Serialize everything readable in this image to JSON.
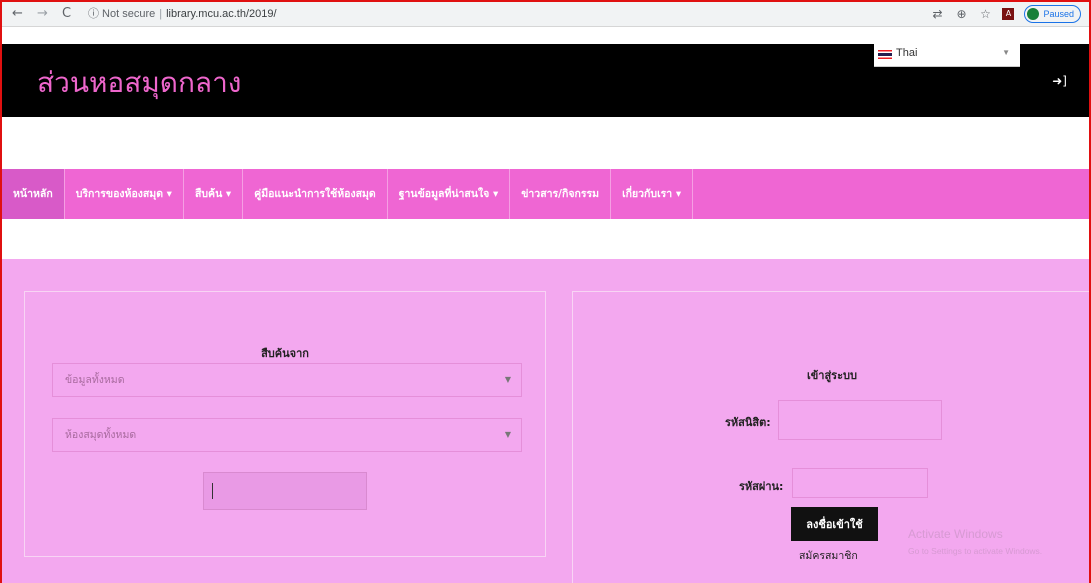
{
  "browser": {
    "back": "←",
    "forward": "→",
    "reload": "C",
    "security": "ⓘ Not secure",
    "url": "library.mcu.ac.th/2019/",
    "profile_status": "Paused"
  },
  "header": {
    "title": "ส่วนหอสมุดกลาง",
    "language": "Thai"
  },
  "menu": {
    "items": [
      "หน้าหลัก",
      "บริการของห้องสมุด ▾",
      "สืบค้น ▾",
      "คู่มือแนะนำการใช้ห้องสมุด",
      "ฐานข้อมูลที่น่าสนใจ ▾",
      "ข่าวสาร/กิจกรรม",
      "เกี่ยวกับเรา ▾"
    ]
  },
  "search": {
    "heading": "สืบค้นจาก",
    "select_data": "ข้อมูลทั้งหมด",
    "select_library": "ห้องสมุดทั้งหมด"
  },
  "login": {
    "heading": "เข้าสู่ระบบ",
    "student_id_label": "รหัสนิสิต:",
    "password_label": "รหัสผ่าน:",
    "submit": "ลงชื่อเข้าใช้",
    "register": "สมัครสมาชิก"
  },
  "watermark": {
    "line1": "Activate Windows",
    "line2": "Go to Settings to activate Windows."
  },
  "colors": {
    "menu_bg": "#ef66d3",
    "content_bg": "#f3a8ef",
    "title": "#ee66cc"
  }
}
